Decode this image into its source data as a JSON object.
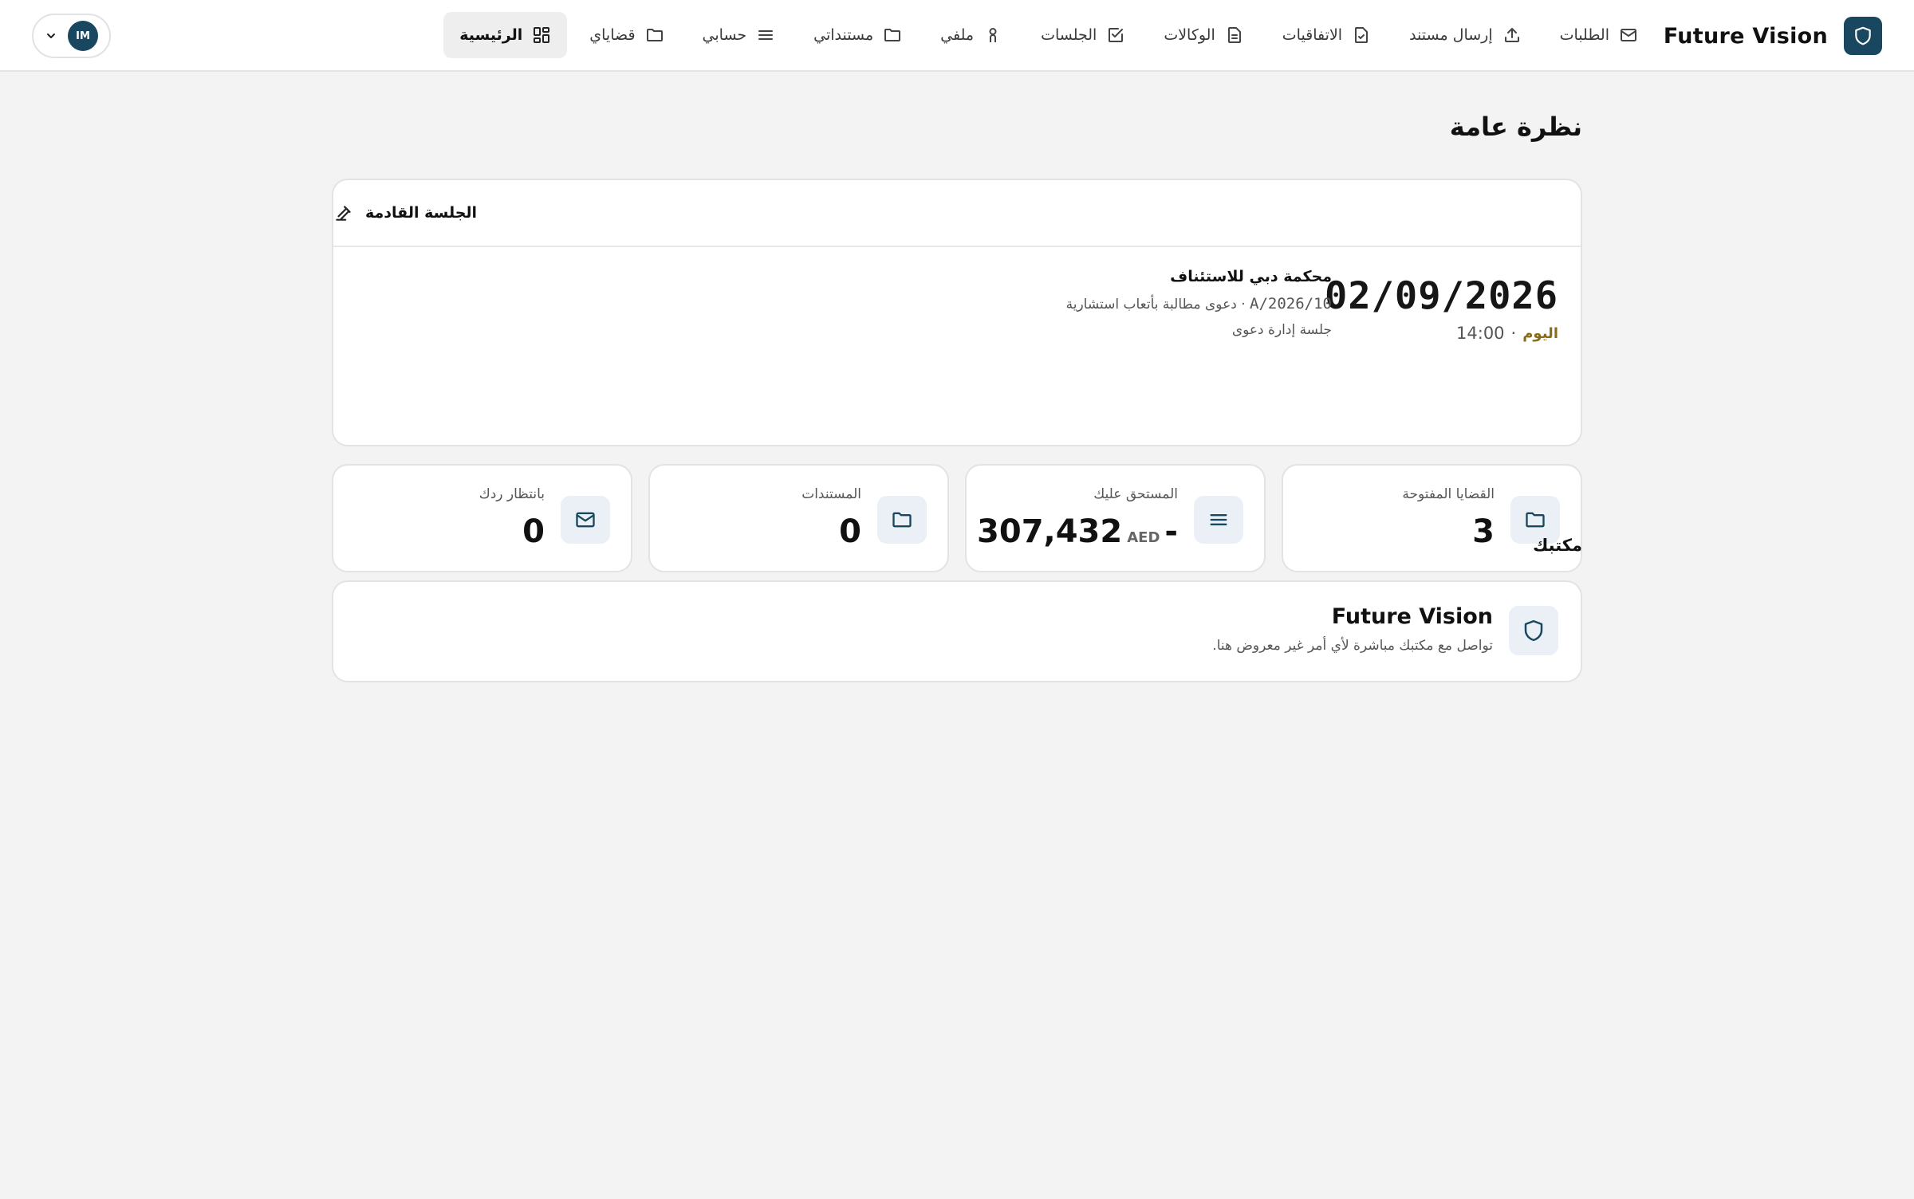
{
  "brand": {
    "name": "Future Vision"
  },
  "nav": [
    {
      "label": "الرئيسية",
      "icon": "dashboard-icon",
      "active": true
    },
    {
      "label": "قضاياي",
      "icon": "folder-icon",
      "active": false
    },
    {
      "label": "حسابي",
      "icon": "menu-lines-icon",
      "active": false
    },
    {
      "label": "مستنداتي",
      "icon": "folder-icon",
      "active": false
    },
    {
      "label": "ملفي",
      "icon": "user-icon",
      "active": false
    },
    {
      "label": "الجلسات",
      "icon": "check-square-icon",
      "active": false
    },
    {
      "label": "الوكالات",
      "icon": "document-icon",
      "active": false
    },
    {
      "label": "الاتفاقيات",
      "icon": "file-check-icon",
      "active": false
    },
    {
      "label": "إرسال مستند",
      "icon": "upload-icon",
      "active": false
    },
    {
      "label": "الطلبات",
      "icon": "mail-icon",
      "active": false
    }
  ],
  "user": {
    "initials": "IM"
  },
  "page": {
    "title": "نظرة عامة"
  },
  "next_session": {
    "header": "الجلسة القادمة",
    "date": "02/09/2026",
    "today_label": "اليوم",
    "separator": "·",
    "time": "14:00",
    "court": "محكمة دبي للاستئناف",
    "case_number": "10/A/2026",
    "case_title": "· دعوى مطالبة بأتعاب استشارية",
    "session_type": "جلسة إدارة دعوى"
  },
  "stats": [
    {
      "label": "القضايا المفتوحة",
      "value": "3",
      "icon": "folder-icon"
    },
    {
      "label": "المستحق عليك",
      "value": "307,432",
      "currency": "AED",
      "prefix": "-",
      "icon": "menu-lines-icon"
    },
    {
      "label": "المستندات",
      "value": "0",
      "icon": "folder-icon"
    },
    {
      "label": "بانتظار ردك",
      "value": "0",
      "icon": "mail-icon"
    }
  ],
  "office": {
    "heading": "مكتبك",
    "name": "Future Vision",
    "description": "تواصل مع مكتبك مباشرة لأي أمر غير معروض هنا."
  },
  "colors": {
    "brand": "#18475f",
    "accent_today": "#8a6b18",
    "icon_bg": "#eaf0f5",
    "page_bg": "#f3f3f3"
  }
}
